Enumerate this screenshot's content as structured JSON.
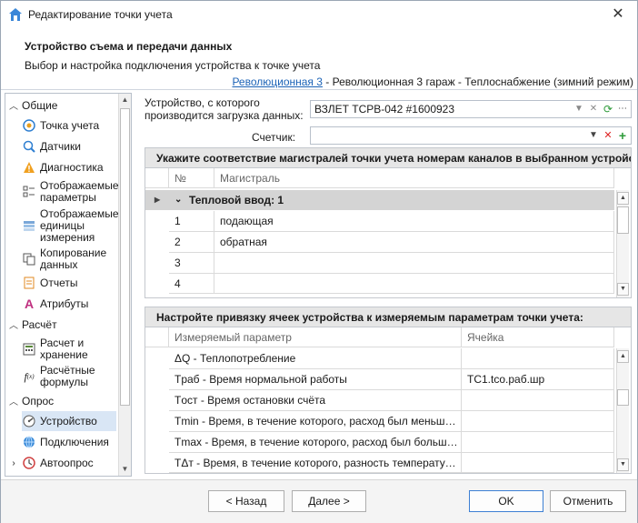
{
  "window": {
    "title": "Редактирование точки учета",
    "close_glyph": "✕"
  },
  "header": {
    "title": "Устройство съема и передачи данных",
    "subtitle": "Выбор и настройка подключения устройства к точке учета",
    "crumb_link": "Революционная 3",
    "crumb_rest": " - Революционная 3 гараж - Теплоснабжение (зимний режим)"
  },
  "sidebar": {
    "groups": [
      {
        "label": "Общие",
        "caret": "⌃"
      },
      {
        "label": "Расчёт",
        "caret": "⌃"
      },
      {
        "label": "Опрос",
        "caret": "⌃"
      }
    ],
    "items": [
      {
        "label": "Точка учета",
        "icon": "target-icon"
      },
      {
        "label": "Датчики",
        "icon": "sensor-icon"
      },
      {
        "label": "Диагностика",
        "icon": "warning-icon"
      },
      {
        "label": "Отображаемые параметры",
        "icon": "checklist-icon"
      },
      {
        "label": "Отображаемые единицы измерения",
        "icon": "units-icon"
      },
      {
        "label": "Копирование данных",
        "icon": "copy-icon"
      },
      {
        "label": "Отчеты",
        "icon": "report-icon"
      },
      {
        "label": "Атрибуты",
        "icon": "attribute-icon"
      },
      {
        "label": "Расчет и хранение",
        "icon": "calc-icon"
      },
      {
        "label": "Расчётные формулы",
        "icon": "formula-icon"
      },
      {
        "label": "Устройство",
        "icon": "device-icon"
      },
      {
        "label": "Подключения",
        "icon": "globe-icon"
      },
      {
        "label": "Автоопрос",
        "icon": "clock-icon"
      }
    ]
  },
  "form": {
    "device_label": "Устройство, с которого производится загрузка данных:",
    "device_value": "ВЗЛЕТ ТСРВ-042 #1600923",
    "counter_label": "Счетчик:",
    "counter_value": ""
  },
  "mains_grid": {
    "caption": "Укажите соответствие магистралей точки учета номерам каналов в выбранном устройстве:",
    "columns": [
      "№",
      "Магистраль"
    ],
    "group_label": "Тепловой ввод: 1",
    "rows": [
      {
        "n": "1",
        "name": "подающая"
      },
      {
        "n": "2",
        "name": "обратная"
      },
      {
        "n": "3",
        "name": ""
      },
      {
        "n": "4",
        "name": ""
      }
    ]
  },
  "params_grid": {
    "caption": "Настройте привязку ячеек устройства к измеряемым параметрам точки учета:",
    "columns": [
      "Измеряемый параметр",
      "Ячейка"
    ],
    "rows": [
      {
        "param": "ΔQ - Теплопотребление",
        "cell": ""
      },
      {
        "param": "Tраб - Время нормальной работы",
        "cell": "TC1.tco.раб.шр"
      },
      {
        "param": "Tост - Время остановки счёта",
        "cell": ""
      },
      {
        "param": "Tmin - Время, в течение которого, расход был меньше минимального",
        "cell": ""
      },
      {
        "param": "Tmax - Время, в течение которого, расход был больше максимального",
        "cell": ""
      },
      {
        "param": "TΔт - Время, в течение которого, разность температур была меньше",
        "cell": ""
      }
    ]
  },
  "footer": {
    "back": "< Назад",
    "next": "Далее >",
    "ok": "OK",
    "cancel": "Отменить"
  },
  "colors": {
    "accent": "#1c63b7",
    "selected_bg": "#d9e6f5",
    "group_row": "#d4d4d4",
    "caption_bg": "#e6e6e6"
  }
}
